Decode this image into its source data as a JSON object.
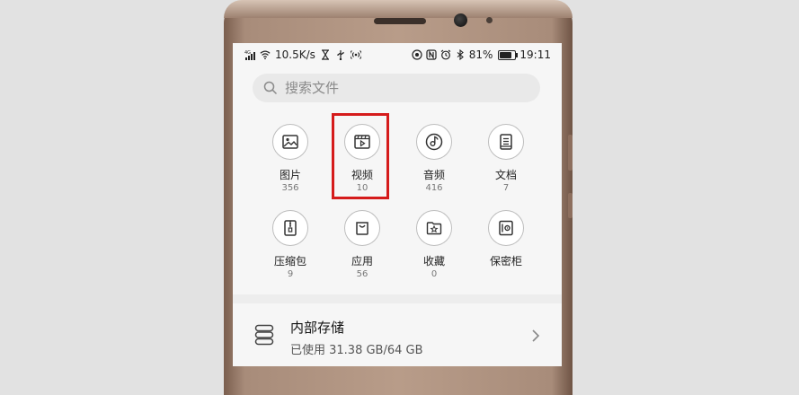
{
  "status_bar": {
    "network_speed": "10.5K/s",
    "battery_percent": "81%",
    "battery_level": 0.81,
    "time": "19:11"
  },
  "search": {
    "placeholder": "搜索文件"
  },
  "categories": [
    {
      "label": "图片",
      "count": "356",
      "icon": "image-icon"
    },
    {
      "label": "视频",
      "count": "10",
      "icon": "video-icon"
    },
    {
      "label": "音频",
      "count": "416",
      "icon": "audio-icon"
    },
    {
      "label": "文档",
      "count": "7",
      "icon": "document-icon"
    },
    {
      "label": "压缩包",
      "count": "9",
      "icon": "archive-icon"
    },
    {
      "label": "应用",
      "count": "56",
      "icon": "app-bag-icon"
    },
    {
      "label": "收藏",
      "count": "0",
      "icon": "favorites-folder-icon"
    },
    {
      "label": "保密柜",
      "count": "",
      "icon": "safe-icon"
    }
  ],
  "highlight": {
    "target": "视频",
    "color": "#d51b1b"
  },
  "storage": {
    "title": "内部存储",
    "usage": "已使用 31.38 GB/64 GB"
  }
}
